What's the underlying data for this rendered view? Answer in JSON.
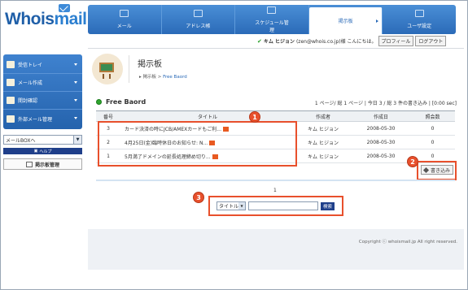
{
  "app": {
    "logo_main": "Whois",
    "logo_accent": "mail"
  },
  "nav": [
    {
      "label": "メール",
      "icon": "mail-icon",
      "active": false
    },
    {
      "label": "アドレス帳",
      "icon": "address-book-icon",
      "active": false
    },
    {
      "label": "スケジュール管理",
      "icon": "schedule-icon",
      "active": false
    },
    {
      "label": "掲示板",
      "icon": "board-icon",
      "active": true
    },
    {
      "label": "ユーザ設定",
      "icon": "user-settings-icon",
      "active": false
    }
  ],
  "userbar": {
    "name": "キム ヒジョン",
    "email_greeting": "(zen@whois.co.jp)様 こんにちは。",
    "profile_btn": "プロフィール",
    "logout_btn": "ログアウト"
  },
  "sidebar": {
    "items": [
      {
        "label": "受信トレイ",
        "icon": "inbox-icon"
      },
      {
        "label": "メール作成",
        "icon": "compose-icon"
      },
      {
        "label": "開封確認",
        "icon": "read-confirm-icon"
      },
      {
        "label": "外部メール管理",
        "icon": "external-mail-icon"
      }
    ],
    "mailbox_select": "メールBOXへ",
    "help": "ヘルプ",
    "board_mgmt": "掲示板管理"
  },
  "page": {
    "title": "掲示板",
    "crumb_root": "掲示板",
    "crumb_current": "Free Baord"
  },
  "board": {
    "title": "Free Baord",
    "info": "1 ページ/ 総 1 ページ | 今日 3 / 総 3 件の書き込み | [0:00 sec]",
    "columns": [
      "番号",
      "タイトル",
      "作成者",
      "作成日",
      "照会数"
    ],
    "rows": [
      {
        "no": "3",
        "title": "カード決済の時にJCB/AMEXカードもご利...",
        "author": "キム ヒジョン",
        "date": "2008-05-30",
        "views": "0"
      },
      {
        "no": "2",
        "title": "4月25日(金)臨時休日のお知らせ: N...",
        "author": "キム ヒジョン",
        "date": "2008-05-30",
        "views": "0"
      },
      {
        "no": "1",
        "title": "5月満了ドメインの延長処理締め切り...",
        "author": "キム ヒジョン",
        "date": "2008-05-30",
        "views": "0"
      }
    ],
    "write_btn": "書き込み",
    "pager": "1"
  },
  "search": {
    "field_select": "タイトル",
    "button": "検索"
  },
  "callouts": [
    "1",
    "2",
    "3"
  ],
  "footer": {
    "copyright": "Copyright ⓒ whoismail.jp All right reserved."
  },
  "colors": {
    "brand_blue": "#2b6bb8",
    "callout_red": "#e8502c",
    "new_badge": "#e85a21"
  }
}
